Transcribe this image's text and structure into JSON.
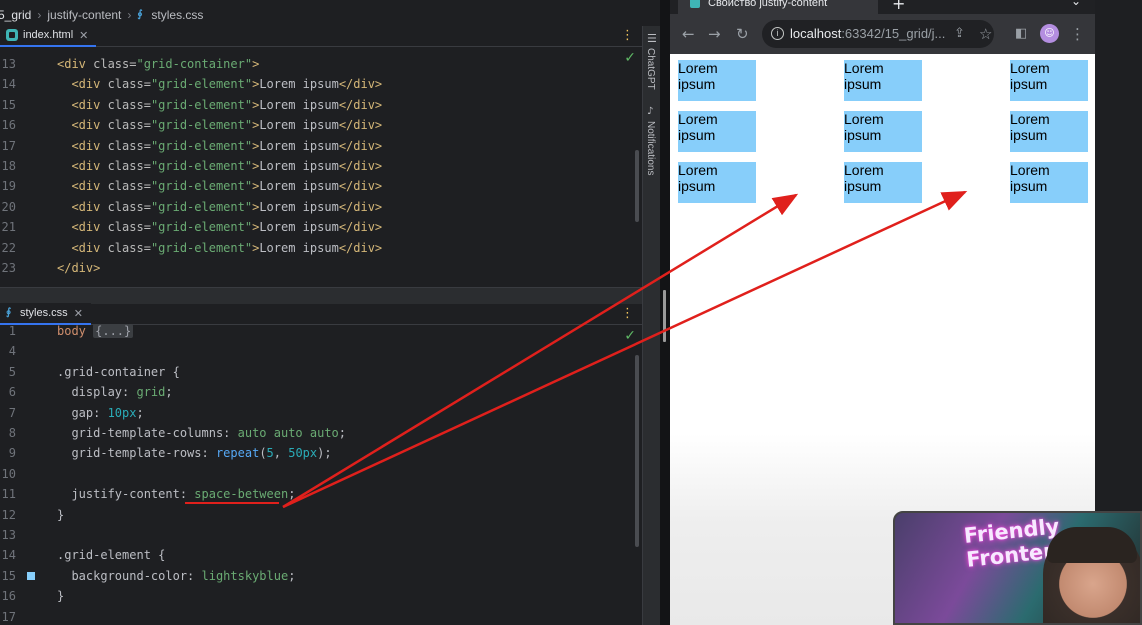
{
  "breadcrumb": [
    "5_grid",
    "justify-content",
    "styles.css"
  ],
  "html_editor": {
    "tab_label": "index.html",
    "lines": [
      {
        "n": "13",
        "tokens": [
          [
            "tag",
            "<div "
          ],
          [
            "attr",
            "class="
          ],
          [
            "str",
            "\"grid-container\""
          ],
          [
            "tag",
            ">"
          ]
        ]
      },
      {
        "n": "14",
        "tokens": [
          [
            "tag",
            "  <div "
          ],
          [
            "attr",
            "class="
          ],
          [
            "str",
            "\"grid-element\""
          ],
          [
            "tag",
            ">"
          ],
          [
            "sel",
            "Lorem ipsum"
          ],
          [
            "tag",
            "</div>"
          ]
        ]
      },
      {
        "n": "15",
        "tokens": [
          [
            "tag",
            "  <div "
          ],
          [
            "attr",
            "class="
          ],
          [
            "str",
            "\"grid-element\""
          ],
          [
            "tag",
            ">"
          ],
          [
            "sel",
            "Lorem ipsum"
          ],
          [
            "tag",
            "</div>"
          ]
        ]
      },
      {
        "n": "16",
        "tokens": [
          [
            "tag",
            "  <div "
          ],
          [
            "attr",
            "class="
          ],
          [
            "str",
            "\"grid-element\""
          ],
          [
            "tag",
            ">"
          ],
          [
            "sel",
            "Lorem ipsum"
          ],
          [
            "tag",
            "</div>"
          ]
        ]
      },
      {
        "n": "17",
        "tokens": [
          [
            "tag",
            "  <div "
          ],
          [
            "attr",
            "class="
          ],
          [
            "str",
            "\"grid-element\""
          ],
          [
            "tag",
            ">"
          ],
          [
            "sel",
            "Lorem ipsum"
          ],
          [
            "tag",
            "</div>"
          ]
        ]
      },
      {
        "n": "18",
        "tokens": [
          [
            "tag",
            "  <div "
          ],
          [
            "attr",
            "class="
          ],
          [
            "str",
            "\"grid-element\""
          ],
          [
            "tag",
            ">"
          ],
          [
            "sel",
            "Lorem ipsum"
          ],
          [
            "tag",
            "</div>"
          ]
        ]
      },
      {
        "n": "19",
        "tokens": [
          [
            "tag",
            "  <div "
          ],
          [
            "attr",
            "class="
          ],
          [
            "str",
            "\"grid-element\""
          ],
          [
            "tag",
            ">"
          ],
          [
            "sel",
            "Lorem ipsum"
          ],
          [
            "tag",
            "</div>"
          ]
        ]
      },
      {
        "n": "20",
        "tokens": [
          [
            "tag",
            "  <div "
          ],
          [
            "attr",
            "class="
          ],
          [
            "str",
            "\"grid-element\""
          ],
          [
            "tag",
            ">"
          ],
          [
            "sel",
            "Lorem ipsum"
          ],
          [
            "tag",
            "</div>"
          ]
        ]
      },
      {
        "n": "21",
        "tokens": [
          [
            "tag",
            "  <div "
          ],
          [
            "attr",
            "class="
          ],
          [
            "str",
            "\"grid-element\""
          ],
          [
            "tag",
            ">"
          ],
          [
            "sel",
            "Lorem ipsum"
          ],
          [
            "tag",
            "</div>"
          ]
        ]
      },
      {
        "n": "22",
        "tokens": [
          [
            "tag",
            "  <div "
          ],
          [
            "attr",
            "class="
          ],
          [
            "str",
            "\"grid-element\""
          ],
          [
            "tag",
            ">"
          ],
          [
            "sel",
            "Lorem ipsum"
          ],
          [
            "tag",
            "</div>"
          ]
        ]
      },
      {
        "n": "23",
        "tokens": [
          [
            "tag",
            "</div>"
          ]
        ]
      }
    ]
  },
  "css_editor": {
    "tab_label": "styles.css",
    "lines": [
      {
        "n": "1",
        "tokens": [
          [
            "kw",
            "body "
          ],
          [
            "folded",
            "{...}"
          ]
        ]
      },
      {
        "n": "4",
        "tokens": []
      },
      {
        "n": "5",
        "tokens": [
          [
            "sel",
            ".grid-container "
          ],
          [
            "punc",
            "{"
          ]
        ]
      },
      {
        "n": "6",
        "tokens": [
          [
            "prop",
            "  display: "
          ],
          [
            "val",
            "grid"
          ],
          [
            "punc",
            ";"
          ]
        ]
      },
      {
        "n": "7",
        "tokens": [
          [
            "prop",
            "  gap: "
          ],
          [
            "num",
            "10px"
          ],
          [
            "punc",
            ";"
          ]
        ]
      },
      {
        "n": "8",
        "tokens": [
          [
            "prop",
            "  grid-template-columns: "
          ],
          [
            "val",
            "auto auto auto"
          ],
          [
            "punc",
            ";"
          ]
        ]
      },
      {
        "n": "9",
        "tokens": [
          [
            "prop",
            "  grid-template-rows: "
          ],
          [
            "fn",
            "repeat"
          ],
          [
            "punc",
            "("
          ],
          [
            "num",
            "5"
          ],
          [
            "punc",
            ", "
          ],
          [
            "num",
            "50px"
          ],
          [
            "punc",
            ");"
          ]
        ]
      },
      {
        "n": "10",
        "tokens": []
      },
      {
        "n": "11",
        "tokens": [
          [
            "prop",
            "  justify-content: "
          ],
          [
            "val",
            "space-between"
          ],
          [
            "punc",
            ";"
          ]
        ]
      },
      {
        "n": "12",
        "tokens": [
          [
            "punc",
            "}"
          ]
        ]
      },
      {
        "n": "13",
        "tokens": []
      },
      {
        "n": "14",
        "tokens": [
          [
            "sel",
            ".grid-element "
          ],
          [
            "punc",
            "{"
          ]
        ]
      },
      {
        "n": "15",
        "tokens": [
          [
            "prop",
            "  background-color: "
          ],
          [
            "val",
            "lightskyblue"
          ],
          [
            "punc",
            ";"
          ]
        ]
      },
      {
        "n": "16",
        "tokens": [
          [
            "punc",
            "}"
          ]
        ]
      },
      {
        "n": "17",
        "tokens": []
      }
    ]
  },
  "side_tools": [
    "ChatGPT",
    "Notifications"
  ],
  "browser": {
    "tab_title": "Свойство justify-content",
    "url_host": "localhost",
    "url_rest": ":63342/15_grid/j...",
    "grid_items": [
      "Lorem ipsum",
      "Lorem ipsum",
      "Lorem ipsum",
      "Lorem ipsum",
      "Lorem ipsum",
      "Lorem ipsum",
      "Lorem ipsum",
      "Lorem ipsum",
      "Lorem ipsum"
    ]
  },
  "webcam": {
    "sign_text": "Friendly\nFronten"
  },
  "colors": {
    "grid_item": "#87cefa",
    "annotation": "#e0201c",
    "accent": "#3574f0"
  }
}
